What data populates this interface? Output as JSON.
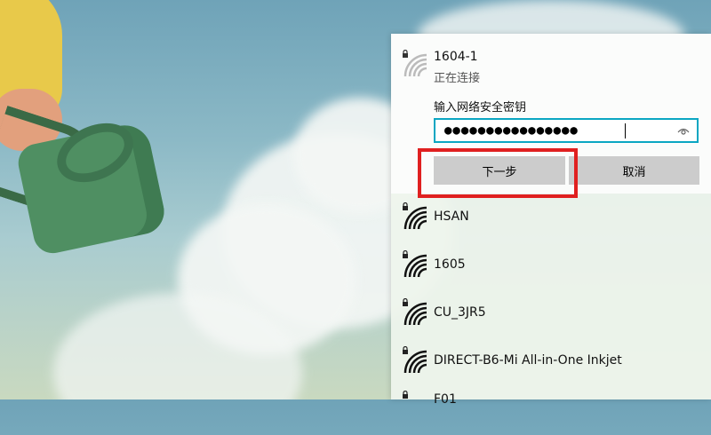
{
  "flyout": {
    "selected_network": {
      "name": "1604-1",
      "status": "正在连接",
      "key_label": "输入网络安全密钥",
      "password_mask": "●●●●●●●●●●●●●●●●",
      "next_label": "下一步",
      "cancel_label": "取消"
    },
    "networks": [
      {
        "name": "HSAN"
      },
      {
        "name": "1605"
      },
      {
        "name": "CU_3JR5"
      },
      {
        "name": "DIRECT-B6-Mi All-in-One Inkjet"
      },
      {
        "name": "F01"
      }
    ]
  },
  "colors": {
    "accent": "#0aa6c2",
    "highlight": "#e02020",
    "button": "#cccccc"
  },
  "icons": [
    "wifi-icon",
    "lock-icon",
    "eye-icon"
  ]
}
